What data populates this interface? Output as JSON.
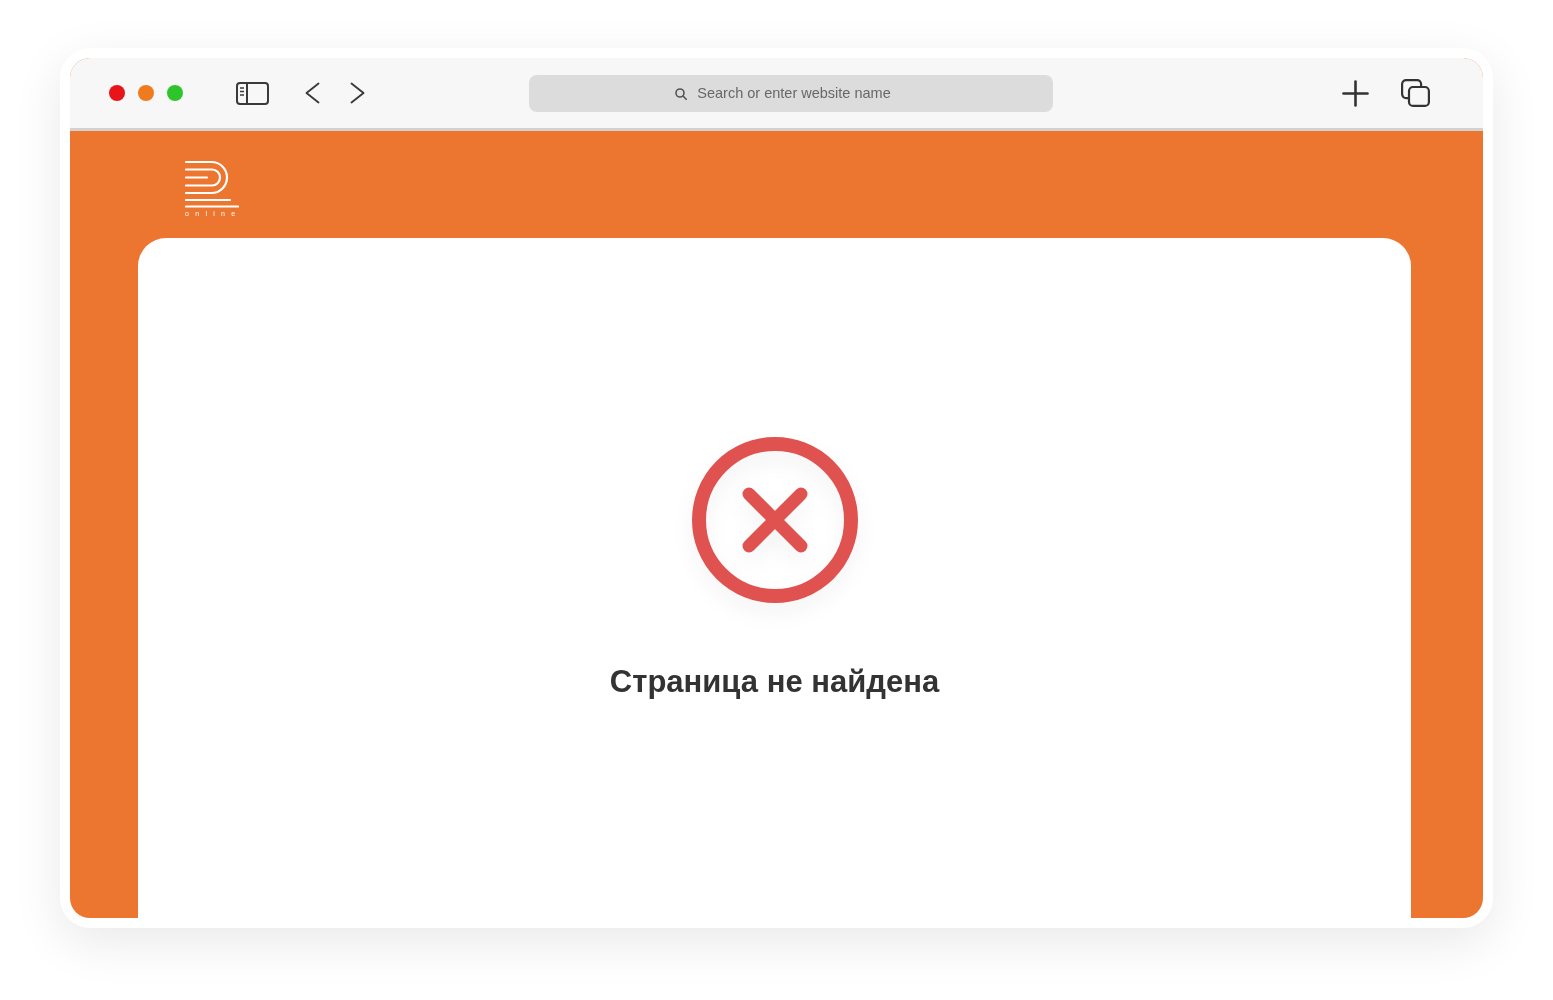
{
  "browser": {
    "traffic_lights": [
      {
        "color": "#e8141a"
      },
      {
        "color": "#f07a1e"
      },
      {
        "color": "#2ec52b"
      }
    ],
    "address_bar": {
      "placeholder": "Search or enter website name"
    }
  },
  "site": {
    "logo": {
      "caption": "online"
    }
  },
  "error": {
    "message": "Страница не найдена"
  }
}
